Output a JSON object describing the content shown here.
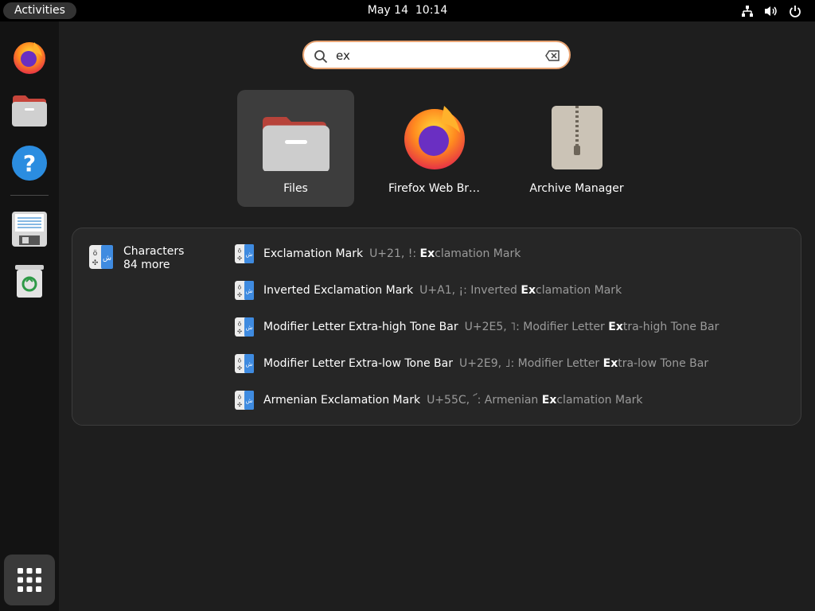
{
  "topbar": {
    "activities_label": "Activities",
    "clock": "May 14  10:14",
    "tray_icons": [
      "network-icon",
      "volume-icon",
      "power-icon"
    ]
  },
  "dock": {
    "items": [
      "firefox-icon",
      "files-icon",
      "help-icon",
      "text-editor-icon",
      "trash-icon"
    ],
    "show_apps_icon": "app-grid-icon"
  },
  "search": {
    "value": "ex",
    "icon": "search-icon",
    "clear_icon": "backspace-icon"
  },
  "apps": [
    {
      "label": "Files",
      "icon": "folder-icon"
    },
    {
      "label": "Firefox Web Br…",
      "icon": "firefox-icon"
    },
    {
      "label": "Archive Manager",
      "icon": "archive-icon"
    }
  ],
  "results": {
    "provider": {
      "name": "Characters",
      "more": "84 more"
    },
    "rows": [
      {
        "title": "Exclamation Mark",
        "desc_pre": "U+21, !: ",
        "desc_bold": "Ex",
        "desc_post": "clamation Mark"
      },
      {
        "title": "Inverted Exclamation Mark",
        "desc_pre": "U+A1, ¡: Inverted ",
        "desc_bold": "Ex",
        "desc_post": "clamation Mark"
      },
      {
        "title": "Modifier Letter Extra-high Tone Bar",
        "desc_pre": "U+2E5, ˥: Modifier Letter ",
        "desc_bold": "Ex",
        "desc_post": "tra-high Tone Bar"
      },
      {
        "title": "Modifier Letter Extra-low Tone Bar",
        "desc_pre": "U+2E9, ˩: Modifier Letter ",
        "desc_bold": "Ex",
        "desc_post": "tra-low Tone Bar"
      },
      {
        "title": "Armenian Exclamation Mark",
        "desc_pre": "U+55C, ՜: Armenian ",
        "desc_bold": "Ex",
        "desc_post": "clamation Mark"
      }
    ]
  },
  "colors": {
    "accent": "#e9a574",
    "selected_tile": "#3d3d3d",
    "panel": "#262626"
  }
}
